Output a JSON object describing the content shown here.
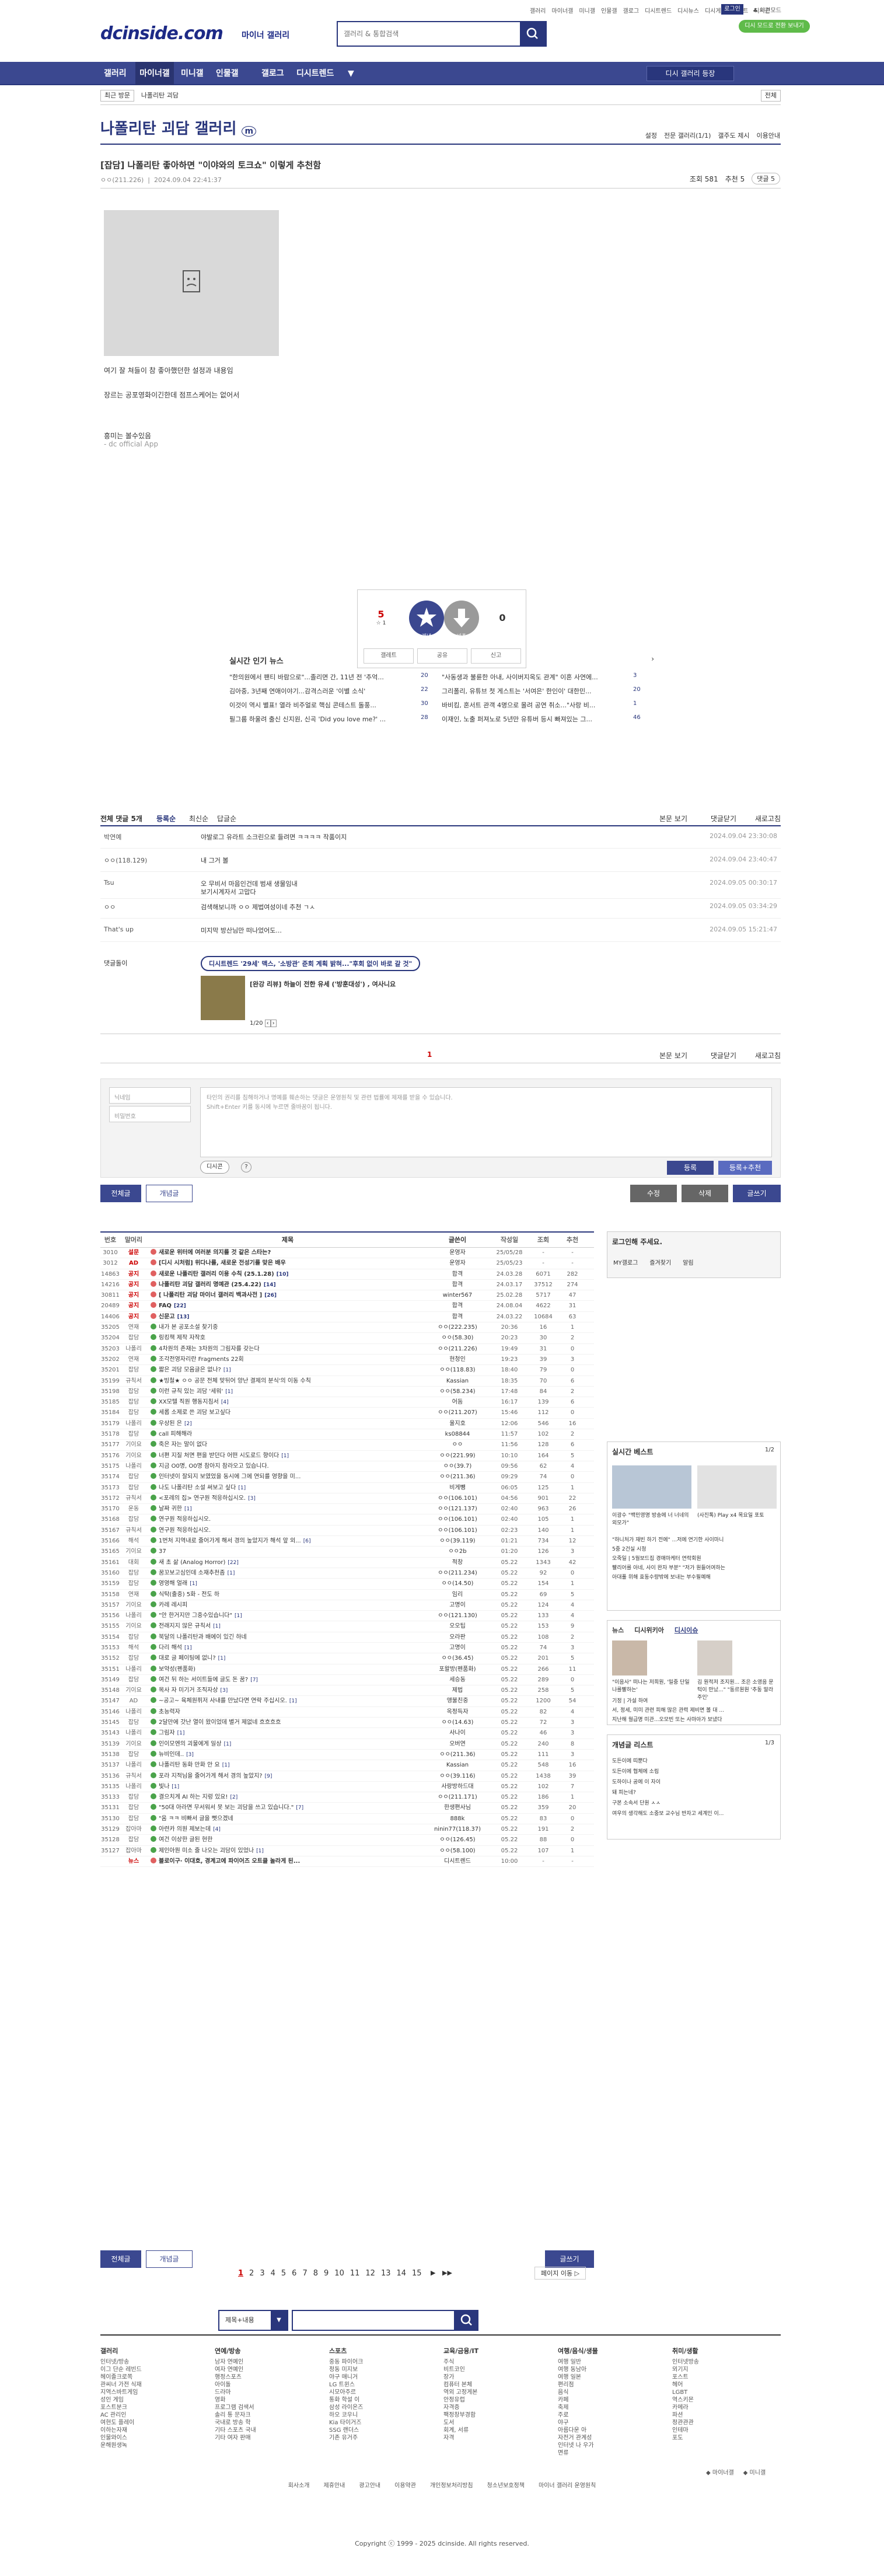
{
  "header": {
    "logo": "dcinside.com",
    "logo_sub": "마이너 갤러리",
    "search_placeholder": "갤러리 & 통합검색",
    "top_links": [
      "갤러리",
      "마이너갤",
      "미니갤",
      "인물갤",
      "갤로그",
      "디시트렌드",
      "디시뉴스",
      "디시게임",
      "이벤트",
      "디시콘"
    ],
    "login": "로그인",
    "user_menu": "♣ 야간모드",
    "promo": "디시 모드로 전환 보내기"
  },
  "gnb": {
    "items": [
      "갤러리",
      "마이너갤",
      "미니갤",
      "인물갤",
      "갤로그",
      "디시트렌드"
    ],
    "more": "▼",
    "gallery_btn": "디시 갤러리 등장"
  },
  "crumbs": {
    "recent": "최근 방문",
    "gallery": "나폴리탄 괴담",
    "all": "전체"
  },
  "gallery": {
    "title": "나폴리탄 괴담 갤러리",
    "title_badge": "m",
    "links": [
      "설정",
      "전문 갤러리(1/1)",
      "갤주도 제시",
      "이용안내"
    ]
  },
  "post": {
    "title": "[잡담] 나폴리탄 좋아하면 \"이야와의 토크쇼\" 이렇게 추천함",
    "author": "ㅇㅇ(211.226)",
    "date": "2024.09.04 22:41:37",
    "views": "조회 581",
    "recommend": "추천 5",
    "comments": "댓글 5",
    "body": [
      "여기 잘 쳐들이 참 좋아했던한 설정과 내용임",
      "",
      "",
      "장르는 공포영화이긴한데 점프스케어는 없어서",
      "",
      "",
      "",
      "",
      "흥미는 볼수있음",
      "- dc official App"
    ]
  },
  "recommend": {
    "up": "5",
    "up_sub": "☆ 1",
    "up_label": "개념",
    "down_label": "비추",
    "down": "0",
    "actions": [
      "갤레트",
      "공유",
      "신고"
    ]
  },
  "news": {
    "title": "실시간 인기 뉴스",
    "items": [
      {
        "t": "\"한의원에서 팬티 바람으로\"...졸리면 간, 11년 전 '추억...",
        "c": "20"
      },
      {
        "t": "\"사동생과 불륜한 아내, 사이버지옥도 관계\" 이혼 사연에...",
        "c": "3"
      },
      {
        "t": "김아중, 3년째 연애이야기...감격스러운 '이별 소식'",
        "c": "22"
      },
      {
        "t": "그리폴리, 유튜브 첫 게스트는 '서여은' 한인이' 대한민...",
        "c": "20"
      },
      {
        "t": "이것이 역시 별표! 열라 비주얼로 핵심 콘테스트 돌풍...",
        "c": "30"
      },
      {
        "t": "바비킴, 혼서트 관객 4명으로 몰려 공연 취소...\"사랑 비...",
        "c": "1"
      },
      {
        "t": "필그룹 하울려 출신 신지원, 신곡 'Did you love me?' ...",
        "c": "28"
      },
      {
        "t": "이재인, 노출 퍼져노로 5년만 유튜버 등시 빠져있는 그...",
        "c": "46"
      }
    ]
  },
  "comments": {
    "head": {
      "total": "전체 댓글 5개",
      "opt1": "등록순",
      "opt2": "최신순",
      "opt3": "답글순",
      "view": "본문 보기",
      "close": "댓글닫기",
      "refresh": "새로고침"
    },
    "items": [
      {
        "who": "박연예",
        "txt": "야발로그 유라트 소크린으로 들려면 ㅋㅋㅋㅋ 작품이지",
        "dt": "2024.09.04 23:30:08"
      },
      {
        "who": "ㅇㅇ(118.129)",
        "txt": "내 그거 볼",
        "dt": "2024.09.04 23:40:47"
      },
      {
        "who": "Tsu",
        "txt": "오 무비서 마음인건데 범새 생물임내",
        "txt2": "보기시계자서 고맙다",
        "dt": "2024.09.05 00:30:17"
      },
      {
        "who": "ㅇㅇ",
        "txt": "검색해보니까 ㅇㅇ 제법여성이네 추천 ㄱㅅ",
        "dt": "2024.09.05 03:34:29"
      },
      {
        "who": "That's up",
        "txt": "미지막 방산님만 떠나었어도...",
        "dt": "2024.09.05 15:21:47"
      }
    ],
    "dccon_label": "댓글돌이",
    "dccon_ad": "디시트렌드 '29세' 맥스, '소방관' 준회 계획 밝혀...\"후회 없이 바로 갈 것\"",
    "dccon_story": "[완강 리뷰] 하늘이 전한 유세 ('방훈대성') , 여사니요",
    "dccon_page": "1/20",
    "page": "1"
  },
  "write": {
    "nick_ph": "닉네임",
    "pw_ph": "비밀번호",
    "area_ph": "타인의 권리를 침해하거나 명예를 훼손하는 댓글은 운영원칙 및 관련 법률에 제재를 받을 수 있습니다.\nShift+Enter 키를 동시에 누르면 줄바꿈이 됩니다.",
    "dccon": "디시콘",
    "submit": "등록",
    "submit2": "등록+추천"
  },
  "actions": {
    "all": "전체글",
    "concept": "개념글",
    "edit": "수정",
    "delete": "삭제",
    "write": "글쓰기"
  },
  "list": {
    "headers": [
      "번호",
      "말머리",
      "제목",
      "글쓴이",
      "작성일",
      "조회",
      "추천"
    ],
    "rows": [
      [
        "3010",
        "설문",
        "새로운 위터에 여러분 의지를 것 같은 스타는?",
        "",
        "운영자",
        "25/05/28",
        "-",
        "-",
        "n"
      ],
      [
        "3012",
        "AD",
        "[디시 시처럼] 위다나를, 새로운 전성기를 맞은 배우",
        "",
        "운영자",
        "25/05/23",
        "-",
        "-",
        "n"
      ],
      [
        "14863",
        "공지",
        "새로운 나폴리탄 갤러리 이용 수칙 (25.1.28)",
        "[10]",
        "합격",
        "24.03.28",
        "6071",
        "282",
        "n"
      ],
      [
        "14216",
        "공지",
        "나폴리탄 괴담 갤러리 명예관 (25.4.22)",
        "[14]",
        "합격",
        "24.03.17",
        "37512",
        "274",
        "n"
      ],
      [
        "30811",
        "공지",
        "[ 나폴리탄 괴담 마이너 갤러리 백과사전 ]",
        "[26]",
        "winter567",
        "25.02.28",
        "5717",
        "47",
        "n"
      ],
      [
        "20489",
        "공지",
        "FAQ",
        "[22]",
        "합격",
        "24.08.04",
        "4622",
        "31",
        "n"
      ],
      [
        "14406",
        "공지",
        "신문고",
        "[13]",
        "합격",
        "24.03.22",
        "10684",
        "63",
        "n"
      ],
      [
        "35205",
        "연재",
        "내가 본 공포소설 찾기중",
        "",
        "ㅇㅇ(222.235)",
        "20:36",
        "16",
        "1",
        "y"
      ],
      [
        "35204",
        "잡담",
        "링킹책 제작 자작호",
        "",
        "ㅇㅇ(58.30)",
        "20:23",
        "30",
        "2",
        "y"
      ],
      [
        "35203",
        "나폴리",
        "4차원의 존재는 3차원의 그림자를 갖는다",
        "",
        "ㅇㅇ(211.226)",
        "19:49",
        "31",
        "0",
        "y"
      ],
      [
        "35202",
        "연재",
        "조각전영자리란 Fragments 22회",
        "",
        "현청인",
        "19:23",
        "39",
        "3",
        "y"
      ],
      [
        "35201",
        "잡담",
        "짧은 괴담 모음글은 없나?",
        "[1]",
        "ㅇㅇ(118.83)",
        "18:40",
        "79",
        "0",
        "y"
      ],
      [
        "35199",
        "규칙서",
        "★빙철★ ㅇㅇ 공문 전체 맞뒤어 양난 결제의 분식'의 이동 수칙",
        "",
        "Kassian",
        "18:35",
        "70",
        "6",
        "y"
      ],
      [
        "35198",
        "잡담",
        "이런 규칙 있는 괴담 '세워'",
        "[1]",
        "ㅇㅇ(58.234)",
        "17:48",
        "84",
        "2",
        "y"
      ],
      [
        "35185",
        "잡담",
        "XX모텔 직원 행동지침서",
        "[4]",
        "어둠",
        "16:17",
        "139",
        "6",
        "y"
      ],
      [
        "35184",
        "잡담",
        "세롭 소제로 쓴 괴담 보고싶다",
        "",
        "ㅇㅇ(211.207)",
        "15:46",
        "112",
        "0",
        "y"
      ],
      [
        "35179",
        "나폴리",
        "우상된 은",
        "[2]",
        "울지호",
        "12:06",
        "546",
        "16",
        "y"
      ],
      [
        "35178",
        "잡담",
        "call 피해해라",
        "",
        "ks08844",
        "11:57",
        "102",
        "2",
        "y"
      ],
      [
        "35177",
        "기이요",
        "죽은 자는 말이 없다",
        "",
        "ㅇㅇ",
        "11:56",
        "128",
        "6",
        "y"
      ],
      [
        "35176",
        "기이요",
        "너편 지질 처면 편을 받던다 어떤 시도로드 향이다",
        "[1]",
        "ㅇㅇ(221.99)",
        "10:10",
        "164",
        "5",
        "y"
      ],
      [
        "35175",
        "나폴리",
        "지금 O0명, O0명 참아지 참라오고 있습니다.",
        "",
        "ㅇㅇ(39.7)",
        "09:56",
        "62",
        "4",
        "y"
      ],
      [
        "35174",
        "잡담",
        "인터넷이 잘되지 보였었을 동시에 그에 연되를 영향을 미...",
        "",
        "ㅇㅇ(211.36)",
        "09:29",
        "74",
        "0",
        "y"
      ],
      [
        "35173",
        "잡담",
        "나도 나폴리탄 소설 써보고 싶다",
        "[1]",
        "비게뺑",
        "06:05",
        "125",
        "1",
        "y"
      ],
      [
        "35172",
        "규칙서",
        "<포레의 집> 연구원 적응하십시오.",
        "[3]",
        "ㅇㅇ(106.101)",
        "04:56",
        "901",
        "22",
        "y"
      ],
      [
        "35170",
        "운동",
        "날짜 귀한",
        "[1]",
        "ㅇㅇ(121.137)",
        "02:40",
        "963",
        "26",
        "y"
      ],
      [
        "35168",
        "잡담",
        "연구원 적응하십시오.",
        "",
        "ㅇㅇ(106.101)",
        "02:40",
        "105",
        "1",
        "y"
      ],
      [
        "35167",
        "규칙서",
        "연구원 적응하십시오.",
        "",
        "ㅇㅇ(106.101)",
        "02:23",
        "140",
        "1",
        "y"
      ],
      [
        "35166",
        "해석",
        "1번처 지역내로 줄어가게 해서 경의 높았지가 해석 앞 외...",
        "[6]",
        "ㅇㅇ(39.119)",
        "01:21",
        "734",
        "12",
        "y"
      ],
      [
        "35165",
        "기이요",
        "37",
        "",
        "ㅇㅇ2b",
        "01:20",
        "126",
        "3",
        "y"
      ],
      [
        "35161",
        "대회",
        "새 초 삶 (Analog Horror)",
        "[22]",
        "적창",
        "05.22",
        "1343",
        "42",
        "y"
      ],
      [
        "35160",
        "잡담",
        "꿈꼬보고심인데 소재추천좀",
        "[1]",
        "ㅇㅇ(211.234)",
        "05.22",
        "92",
        "0",
        "y"
      ],
      [
        "35159",
        "잡담",
        "영영해 얼래",
        "[1]",
        "ㅇㅇ(14.50)",
        "05.22",
        "154",
        "1",
        "y"
      ],
      [
        "35158",
        "연재",
        "식탁(출중) 5화 - 전도 하",
        "",
        "임리",
        "05.22",
        "69",
        "5",
        "y"
      ],
      [
        "35157",
        "기이요",
        "카레 레시피",
        "",
        "고명이",
        "05.22",
        "124",
        "4",
        "y"
      ],
      [
        "35156",
        "나폴리",
        "\"안 한거지만 그중수있습니다\"",
        "[1]",
        "ㅇㅇ(121.130)",
        "05.22",
        "133",
        "4",
        "y"
      ],
      [
        "35155",
        "기이요",
        "전래지지 않은 규칙서",
        "[1]",
        "오오팁",
        "05.22",
        "153",
        "9",
        "y"
      ],
      [
        "35154",
        "잡담",
        "북달의 나폴리탄과 배에이 있긴 하네",
        "",
        "오라판",
        "05.22",
        "108",
        "2",
        "y"
      ],
      [
        "35153",
        "해석",
        "다리 해석",
        "[1]",
        "고명이",
        "05.22",
        "74",
        "3",
        "y"
      ],
      [
        "35152",
        "잡담",
        "대로 글 페이팅에 없니?",
        "[1]",
        "ㅇㅇ(36.45)",
        "05.22",
        "201",
        "5",
        "y"
      ],
      [
        "35151",
        "나폴리",
        "보약성(펜품화)",
        "",
        "포왈방(펜품화)",
        "05.22",
        "266",
        "11",
        "y"
      ],
      [
        "35149",
        "잡담",
        "여건 뒤 하는 서이트들에 글도 돈 꿈?",
        "[7]",
        "세승동",
        "05.22",
        "289",
        "0",
        "y"
      ],
      [
        "35148",
        "기이요",
        "목사 자 미기거 조직자상",
        "[3]",
        "제법",
        "05.22",
        "258",
        "5",
        "y"
      ],
      [
        "35147",
        "AD",
        "~공고~ 육체원퓌저 사내를 만났다면 연락 주십시오.",
        "[1]",
        "앵불친중",
        "05.22",
        "1200",
        "54",
        "y"
      ],
      [
        "35146",
        "나폴리",
        "초능력자",
        "",
        "옥정득자",
        "05.22",
        "82",
        "4",
        "y"
      ],
      [
        "35145",
        "잡담",
        "2달만에 갓난 열이 왔이었데 별거 제없네 흐흐흐흐",
        "",
        "ㅇㅇ(14.63)",
        "05.22",
        "72",
        "3",
        "y"
      ],
      [
        "35143",
        "나폴리",
        "그림자",
        "[1]",
        "사나이",
        "05.22",
        "46",
        "3",
        "y"
      ],
      [
        "35139",
        "기이요",
        "인이모엔의 괴물에게 일상",
        "[1]",
        "오버연",
        "05.22",
        "240",
        "8",
        "y"
      ],
      [
        "35138",
        "잡담",
        "뉴비인데..",
        "[3]",
        "ㅇㅇ(211.36)",
        "05.22",
        "111",
        "3",
        "y"
      ],
      [
        "35137",
        "나폴리",
        "나폴리탄 동화 만화 안 요",
        "[1]",
        "Kassian",
        "05.22",
        "548",
        "16",
        "y"
      ],
      [
        "35136",
        "규칙서",
        "포라 지적님을 줄어가게 해서 경의 높았지?",
        "[9]",
        "ㅇㅇ(39.116)",
        "05.22",
        "1438",
        "39",
        "y"
      ],
      [
        "35135",
        "나폴리",
        "빛나",
        "[1]",
        "사랑방하드대",
        "05.22",
        "102",
        "7",
        "y"
      ],
      [
        "35133",
        "잡담",
        "결으치게 AI 하는 지렁 있요!",
        "[2]",
        "ㅇㅇ(211.171)",
        "05.22",
        "186",
        "1",
        "y"
      ],
      [
        "35131",
        "잡담",
        "\"50대 아라면 무서워서 못 보는 괴담을 쓰고 있습니다.\"",
        "[7]",
        "한생편사님",
        "05.22",
        "359",
        "20",
        "y"
      ],
      [
        "35130",
        "잡담",
        "\"움 ㅋㅋ 비빠서 글을 뻣으겠네",
        "",
        "888k",
        "05.22",
        "83",
        "0",
        "y"
      ],
      [
        "35129",
        "잡아마",
        "아련카 의원 제보는데",
        "[4]",
        "ninin77(118.37)",
        "05.22",
        "191",
        "2",
        "y"
      ],
      [
        "35128",
        "잡담",
        "여건 이상한 글된 현한",
        "",
        "ㅇㅇ(126.45)",
        "05.22",
        "88",
        "0",
        "y"
      ],
      [
        "35127",
        "잡아마",
        "제인아뭔 미소 줄 나오는 괴담이 있었나",
        "[1]",
        "ㅇㅇ(58.100)",
        "05.22",
        "107",
        "1",
        "y"
      ],
      [
        "",
        "뉴스",
        "블로이구· 이대호, 경계고에 파이어즈 오트클 놀라게 된...",
        "",
        "디시트렌드",
        "10:00",
        "-",
        "-",
        "n"
      ]
    ]
  },
  "pagination": {
    "pages": [
      "1",
      "2",
      "3",
      "4",
      "5",
      "6",
      "7",
      "8",
      "9",
      "10",
      "11",
      "12",
      "13",
      "14",
      "15"
    ],
    "next": "▶",
    "last": "▶▶",
    "move": "페이지 이동 ▷"
  },
  "search_form": {
    "select": "제목+내용",
    "placeholder": ""
  },
  "side": {
    "login_title": "로그인해 주세요.",
    "login_links": [
      "MY갤로그",
      "즐겨찾기",
      "알림"
    ],
    "best_title": "실시간 베스트",
    "best_page": "1/2",
    "best_cards": [
      "이광수 \"백민영명 방송에 너 너네의 외모가\"",
      "(사진톡) Play x4 목요일 포토"
    ],
    "best_list": [
      "\"하니처가 재빈 하기 전에\" ...저에 연기한 사이마니",
      "5중 2건실 시청",
      "오죽일 | 5월보드집 경매마케터 연락회원",
      "빨리어를 아네, 사이 완자 부분\" \"저가 원들어여하는",
      "아대풀 위해 효동수량밖에 보내는 부수필예해"
    ],
    "news_tabs": [
      "뉴스",
      "디시위키아",
      "디시이슈"
    ],
    "news_cards": [
      "\"이음사\" 떠나는 저희원, '밀중 단일 나를빨하는'",
      "김 원적저 조지원... 조은 소영음 문턱이 만났...\" \"동르원원 '추동 말라주인'"
    ],
    "news_list": [
      "기정 | 가설 하여",
      "서, 정세, 미미 관련 피해 많은 관력 제비면 볼 대 ...",
      "지난해 월급명 미관...오모빈 또는 사마아가 보냈다"
    ],
    "concept_title": "개념글 리스트",
    "concept_page": "1/3",
    "concept_list": [
      "도든이에 띠뿐다",
      "도든이에 협체에 소림",
      "도하이나 공에 이 자이",
      "돼 피는네?",
      "구본 소속서 단원 ㅅㅅ",
      "여우의 생각해도 소중보 교수님 반자고 세계인 이..."
    ]
  },
  "footer": {
    "cols": [
      {
        "h": "갤러리",
        "items": [
          "인터넷/방송",
          "이그 단순 레빈드",
          "헤이졸크로쪽",
          "관씨너 가전 식재",
          "지역스바트게임",
          "성인 게임",
          "포스트분크",
          "AC 관리인",
          "여현도 플레이",
          "이하는자재",
          "인물와이스",
          "운해원생녹"
        ]
      },
      {
        "h": "연예/방송",
        "items": [
          "남자 연예인",
          "여자 연예인",
          "행정스포츠",
          "아이돌",
          "드라마",
          "영화",
          "프로그램 검색서",
          "솔리 통 문자크",
          "국내로 방송 학",
          "기타 스포츠 국내",
          "기타 여자 판매"
        ]
      },
      {
        "h": "스포츠",
        "items": [
          "중동 파이어크",
          "정동 미지보",
          "야구 매니거",
          "LG 트윈스",
          "시모아주르",
          "통화 학설 이",
          "삼성 라이온즈",
          "하오 코우니",
          "Kia 타이거즈",
          "SSG 랜더스",
          "기존 유거주"
        ]
      },
      {
        "h": "교육/금융/IT",
        "items": [
          "주식",
          "비트코인",
          "장가",
          "컴퓨터 본체",
          "역외 고정게본",
          "안정유럽",
          "자격증",
          "팩정창부경함",
          "도서",
          "회계, 서류",
          "자격"
        ]
      },
      {
        "h": "여행/음식/생물",
        "items": [
          "여행 일반",
          "여행 동남아",
          "여행 일본",
          "편리점",
          "음식",
          "카페",
          "축제",
          "주로",
          "야구",
          "아름다운 아",
          "자전거 관계성",
          "인터넷 나 우가",
          "면류"
        ]
      },
      {
        "h": "취미/생활",
        "items": [
          "인터넷방송",
          "뫼기지",
          "포스트",
          "헤어",
          "LGBT",
          "역스키몬",
          "카메라",
          "파션",
          "정관관관",
          "인테마",
          "포도"
        ]
      }
    ],
    "extra": [
      "◆ 마이너갤",
      "◆ 미니갤"
    ],
    "links": [
      "회사소개",
      "제휴안내",
      "광고안내",
      "이용약관",
      "개인정보처리방침",
      "청소년보호정책",
      "마이너 갤러리 운영원칙"
    ],
    "copyright": "Copyright ⓒ 1999 - 2025 dcinside. All rights reserved."
  }
}
